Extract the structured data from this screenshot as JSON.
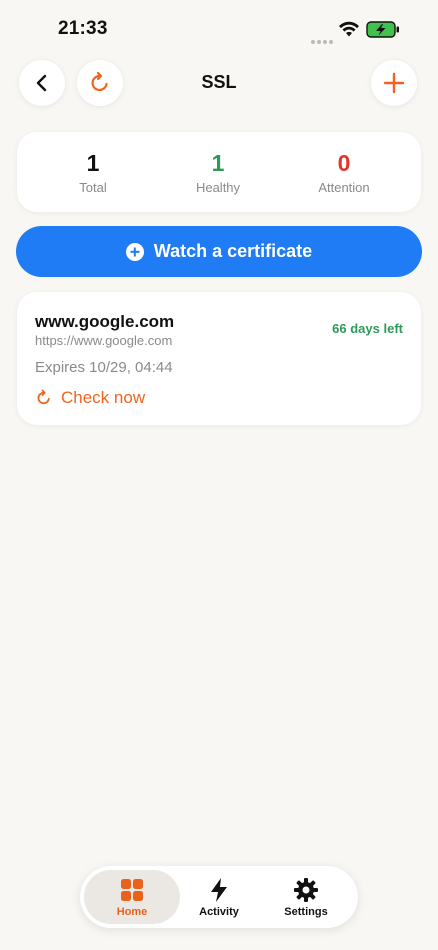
{
  "status_bar": {
    "time": "21:33"
  },
  "header": {
    "title": "SSL"
  },
  "stats": {
    "total": {
      "value": "1",
      "label": "Total"
    },
    "healthy": {
      "value": "1",
      "label": "Healthy"
    },
    "attention": {
      "value": "0",
      "label": "Attention"
    }
  },
  "watch_button": {
    "label": "Watch a certificate"
  },
  "certificate": {
    "domain": "www.google.com",
    "url": "https://www.google.com",
    "days_left": "66 days left",
    "expires": "Expires 10/29, 04:44",
    "check_label": "Check now"
  },
  "tabs": [
    {
      "label": "Home",
      "icon": "grid-icon",
      "active": true
    },
    {
      "label": "Activity",
      "icon": "bolt-icon",
      "active": false
    },
    {
      "label": "Settings",
      "icon": "gear-icon",
      "active": false
    }
  ],
  "colors": {
    "accent": "#1f7cf4",
    "orange": "#f0641e",
    "healthy": "#2e9a5a",
    "attention": "#d93a2b",
    "background": "#f8f7f3"
  }
}
